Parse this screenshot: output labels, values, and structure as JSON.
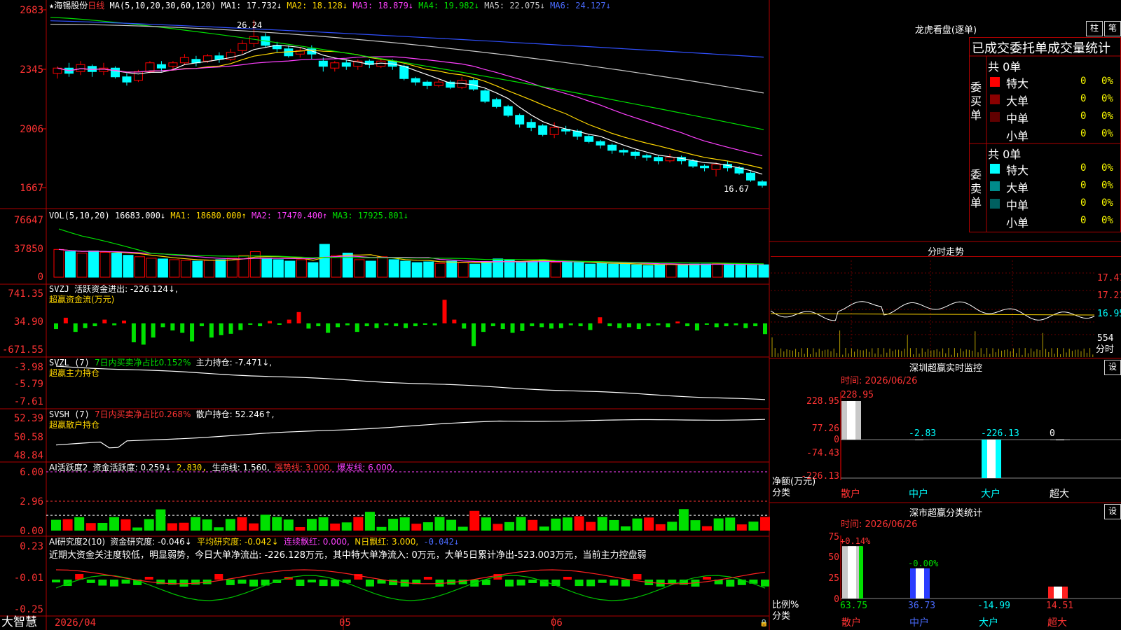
{
  "stock": {
    "star": "★",
    "name": "海锡股份",
    "period": "日线"
  },
  "ma": {
    "label": "MA(5,10,20,30,60,120)",
    "ma1": "MA1: 17.732↓",
    "ma2": "MA2: 18.128↓",
    "ma3": "MA3: 18.879↓",
    "ma4": "MA4: 19.982↓",
    "ma5": "MA5: 22.075↓",
    "ma6": "MA6: 24.127↓"
  },
  "main_axis": [
    "2683",
    "2345",
    "2006",
    "1667"
  ],
  "high_label": "26.24",
  "low_label": "16.67",
  "vol": {
    "label": "VOL(5,10,20)",
    "value": "16683.000↓",
    "ma1": "MA1: 18680.000↑",
    "ma2": "MA2: 17470.400↑",
    "ma3": "MA3: 17925.801↓",
    "axis": [
      "76647",
      "37850",
      "0"
    ]
  },
  "svzj": {
    "label": "SVZJ",
    "text": "活跃资金进出: -226.124↓,",
    "sub": "超赢资金流(万元)",
    "axis": [
      "741.35",
      "34.90",
      "-671.55"
    ]
  },
  "svzl": {
    "label": "SVZL (7)",
    "ratio": "7日内买卖净占比0.152%",
    "hold": "主力持仓: -7.471↓,",
    "sub": "超赢主力持仓",
    "axis": [
      "-3.98",
      "-5.79",
      "-7.61"
    ]
  },
  "svsh": {
    "label": "SVSH (7)",
    "ratio": "7日内买卖净占比0.268%",
    "hold": "散户持仓: 52.246↑,",
    "sub": "超赢散户持仓",
    "axis": [
      "52.39",
      "50.58",
      "48.84"
    ]
  },
  "ai1": {
    "label": "AI活跃度2",
    "t1": "资金活跃度: 0.259↓",
    "t2": "2.830,",
    "t3": "生命线: 1.560,",
    "t4": "强势线: 3.000,",
    "t5": "爆发线: 6.000,",
    "axis": [
      "6.00",
      "2.96",
      "0.00"
    ]
  },
  "ai2": {
    "label": "AI研究度2(10)",
    "t1": "资金研究度: -0.046↓",
    "t2": "平均研究度: -0.042↓",
    "t3": "连续飘红: 0.000,",
    "t4": "N日飘红: 3.000,",
    "t5": "-0.042↓",
    "note": "近期大资金关注度较低，明显弱势，今日大单净流出: -226.128万元，其中特大单净流入: 0万元，大单5日累计净出-523.003万元，当前主力控盘弱",
    "axis": [
      "0.23",
      "-0.01",
      "-0.25"
    ]
  },
  "xaxis": {
    "brand": "大智慧",
    "d1": "2026/04",
    "d2": "05",
    "d3": "06"
  },
  "lhb": {
    "title": "龙虎看盘(逐单)",
    "btn1": "柱",
    "btn2": "笔",
    "header": "已成交委托单成交量统计",
    "buy": {
      "vlabel": "委买单",
      "total": "共 0单",
      "rows": [
        {
          "name": "特大",
          "v": "0",
          "p": "0%",
          "color": "#ff0000"
        },
        {
          "name": "大单",
          "v": "0",
          "p": "0%",
          "color": "#8b0000"
        },
        {
          "name": "中单",
          "v": "0",
          "p": "0%",
          "color": "#600000"
        },
        {
          "name": "小单",
          "v": "0",
          "p": "0%",
          "color": "#000000"
        }
      ]
    },
    "sell": {
      "vlabel": "委卖单",
      "total": "共 0单",
      "rows": [
        {
          "name": "特大",
          "v": "0",
          "p": "0%",
          "color": "#00ffff"
        },
        {
          "name": "大单",
          "v": "0",
          "p": "0%",
          "color": "#008b8b"
        },
        {
          "name": "中单",
          "v": "0",
          "p": "0%",
          "color": "#006060"
        },
        {
          "name": "小单",
          "v": "0",
          "p": "0%",
          "color": "#000000"
        }
      ]
    }
  },
  "fenshi": {
    "title": "分时走势",
    "axis": [
      "17.47",
      "17.21",
      "16.95",
      "554",
      "分时"
    ]
  },
  "monitor": {
    "title": "深圳超赢实时监控",
    "btn": "设",
    "time": "时间: 2026/06/26",
    "axis": [
      "228.95",
      "77.26",
      "0",
      "-74.43",
      "-226.13"
    ],
    "ylabel": "净额(万元)",
    "xlabel": "分类",
    "cats": [
      "散户",
      "中户",
      "大户",
      "超大"
    ],
    "values": [
      228.95,
      -2.83,
      -226.13,
      0
    ],
    "labels": [
      "228.95",
      "-2.83",
      "-226.13",
      "0"
    ]
  },
  "classify": {
    "title": "深市超赢分类统计",
    "btn": "设",
    "time": "时间: 2026/06/26",
    "axis": [
      "75",
      "50",
      "25",
      "0"
    ],
    "ylabel": "比例%",
    "xlabel": "分类",
    "cats": [
      "散户",
      "中户",
      "大户",
      "超大"
    ],
    "values": [
      63.75,
      36.73,
      -14.99,
      14.51
    ],
    "labels": [
      "63.75",
      "36.73",
      "-14.99",
      "14.51"
    ],
    "tops": [
      "+0.14%",
      "-0.00%",
      "",
      ""
    ]
  },
  "chart_data": [
    {
      "type": "candlestick",
      "title": "海锡股份 日线",
      "ylim": [
        16.67,
        26.83
      ],
      "candles": [
        [
          23.2,
          23.5,
          22.9,
          23.6
        ],
        [
          23.5,
          23.2,
          23.0,
          23.8
        ],
        [
          23.3,
          23.7,
          23.1,
          23.9
        ],
        [
          23.6,
          23.3,
          23.0,
          23.7
        ],
        [
          23.3,
          23.5,
          23.1,
          23.8
        ],
        [
          23.5,
          23.0,
          22.9,
          23.6
        ],
        [
          23.0,
          22.7,
          22.5,
          23.2
        ],
        [
          22.8,
          23.3,
          22.7,
          23.4
        ],
        [
          23.3,
          23.8,
          23.2,
          23.9
        ],
        [
          23.7,
          23.5,
          23.3,
          23.9
        ],
        [
          23.6,
          23.8,
          23.4,
          23.9
        ],
        [
          23.8,
          24.1,
          23.7,
          24.3
        ],
        [
          24.0,
          23.8,
          23.6,
          24.2
        ],
        [
          23.9,
          24.2,
          23.8,
          24.3
        ],
        [
          24.2,
          24.0,
          23.8,
          24.4
        ],
        [
          24.0,
          24.4,
          23.9,
          24.6
        ],
        [
          24.5,
          24.9,
          24.3,
          25.1
        ],
        [
          24.9,
          25.3,
          24.7,
          26.24
        ],
        [
          25.3,
          24.8,
          24.7,
          25.5
        ],
        [
          24.8,
          24.6,
          24.4,
          25.0
        ],
        [
          24.6,
          24.2,
          24.1,
          24.8
        ],
        [
          24.3,
          24.5,
          24.1,
          24.7
        ],
        [
          24.6,
          24.3,
          24.0,
          24.8
        ],
        [
          23.9,
          23.6,
          23.3,
          24.1
        ],
        [
          23.5,
          23.8,
          23.3,
          23.9
        ],
        [
          23.8,
          23.6,
          23.4,
          24.0
        ],
        [
          23.6,
          23.9,
          23.4,
          24.0
        ],
        [
          23.9,
          23.7,
          23.5,
          24.0
        ],
        [
          23.6,
          23.9,
          23.5,
          24.0
        ],
        [
          23.9,
          23.6,
          23.4,
          24.0
        ],
        [
          23.6,
          22.9,
          22.8,
          23.7
        ],
        [
          22.9,
          22.7,
          22.5,
          23.0
        ],
        [
          22.7,
          22.5,
          22.3,
          22.8
        ],
        [
          22.5,
          22.7,
          22.4,
          22.9
        ],
        [
          22.7,
          22.4,
          22.3,
          22.8
        ],
        [
          22.4,
          22.8,
          22.3,
          23.0
        ],
        [
          22.8,
          22.3,
          22.2,
          22.9
        ],
        [
          22.2,
          21.6,
          21.5,
          22.3
        ],
        [
          21.7,
          21.3,
          21.2,
          21.8
        ],
        [
          21.3,
          20.8,
          20.7,
          21.4
        ],
        [
          20.8,
          20.3,
          20.1,
          20.9
        ],
        [
          20.4,
          20.1,
          19.9,
          20.6
        ],
        [
          20.2,
          19.7,
          19.6,
          20.3
        ],
        [
          19.7,
          20.1,
          19.5,
          20.4
        ],
        [
          20.0,
          19.9,
          19.7,
          20.2
        ],
        [
          19.9,
          19.6,
          19.4,
          20.0
        ],
        [
          19.6,
          19.3,
          19.2,
          19.7
        ],
        [
          19.3,
          19.1,
          18.9,
          19.4
        ],
        [
          19.1,
          18.8,
          18.6,
          19.2
        ],
        [
          18.8,
          18.7,
          18.5,
          18.9
        ],
        [
          18.7,
          18.5,
          18.3,
          18.8
        ],
        [
          18.5,
          18.4,
          18.2,
          18.6
        ],
        [
          18.4,
          18.2,
          18.0,
          18.5
        ],
        [
          18.2,
          18.4,
          18.1,
          18.6
        ],
        [
          18.4,
          18.2,
          18.0,
          18.5
        ],
        [
          18.2,
          17.9,
          17.8,
          18.3
        ],
        [
          17.9,
          17.8,
          17.6,
          18.0
        ],
        [
          17.7,
          18.0,
          17.3,
          18.1
        ],
        [
          18.0,
          17.8,
          17.6,
          18.2
        ],
        [
          17.8,
          17.5,
          17.4,
          17.9
        ],
        [
          17.5,
          17.1,
          17.0,
          17.6
        ],
        [
          17.0,
          16.8,
          16.67,
          17.1
        ]
      ],
      "ma_series": {
        "ma1_end": 17.732,
        "ma2_end": 18.128,
        "ma3_end": 18.879,
        "ma4_end": 19.982,
        "ma5_end": 22.075,
        "ma6_end": 24.127
      }
    },
    {
      "type": "bar",
      "title": "VOL(5,10,20)",
      "ylim": [
        0,
        76647
      ],
      "values": [
        38000,
        35000,
        33000,
        36000,
        34000,
        33000,
        30000,
        28000,
        26000,
        25000,
        24000,
        23000,
        22000,
        23000,
        24000,
        26000,
        30000,
        35000,
        26000,
        24000,
        22000,
        24000,
        20000,
        45000,
        30000,
        33000,
        24000,
        22000,
        28000,
        24000,
        22000,
        20000,
        21000,
        19000,
        22000,
        20000,
        18000,
        21000,
        25000,
        24000,
        20000,
        22000,
        23000,
        20000,
        21000,
        20000,
        18000,
        19000,
        18000,
        19000,
        17000,
        16000,
        17000,
        18000,
        17000,
        18000,
        18000,
        19000,
        18000,
        17000,
        16683,
        17000
      ],
      "up": [
        1,
        0,
        1,
        0,
        1,
        0,
        0,
        1,
        1,
        0,
        1,
        1,
        0,
        1,
        0,
        1,
        1,
        1,
        0,
        0,
        0,
        1,
        0,
        0,
        1,
        0,
        1,
        0,
        1,
        0,
        0,
        0,
        0,
        1,
        0,
        1,
        0,
        0,
        0,
        0,
        0,
        0,
        0,
        1,
        0,
        0,
        0,
        0,
        0,
        0,
        0,
        0,
        0,
        1,
        0,
        0,
        0,
        1,
        0,
        0,
        0,
        0
      ]
    },
    {
      "type": "bar",
      "title": "SVZJ 超赢资金流(万元)",
      "ylim": [
        -671.55,
        741.35
      ],
      "values": [
        -120,
        120,
        -180,
        -100,
        -60,
        80,
        -40,
        60,
        -400,
        -450,
        -300,
        -80,
        -150,
        -200,
        -380,
        -60,
        -300,
        -250,
        -220,
        -140,
        -30,
        -60,
        50,
        -20,
        80,
        240,
        -110,
        -60,
        -200,
        -80,
        -40,
        -180,
        -60,
        -100,
        -40,
        -60,
        -100,
        -60,
        -20,
        -40,
        500,
        80,
        -110,
        -480,
        -180,
        -60,
        -120,
        -200,
        -160,
        -60,
        -80,
        -110,
        -100,
        -40,
        -60,
        -140,
        130,
        -60,
        -100,
        -80,
        -120,
        -60,
        -40,
        -80,
        40,
        -60,
        -150,
        -20,
        -80,
        -60,
        -40,
        -100,
        -60,
        -226.124
      ]
    },
    {
      "type": "line",
      "title": "SVZL 超赢主力持仓",
      "ylim": [
        -7.61,
        -3.98
      ]
    },
    {
      "type": "line",
      "title": "SVSH 超赢散户持仓",
      "ylim": [
        48.84,
        52.39
      ]
    },
    {
      "type": "bar",
      "title": "AI活跃度2",
      "ylim": [
        0,
        6
      ]
    },
    {
      "type": "bar",
      "title": "AI研究度2(10)",
      "ylim": [
        -0.25,
        0.23
      ]
    },
    {
      "type": "bar",
      "title": "深圳超赢实时监控",
      "categories": [
        "散户",
        "中户",
        "大户",
        "超大"
      ],
      "values": [
        228.95,
        -2.83,
        -226.13,
        0
      ],
      "ylim": [
        -226.13,
        228.95
      ]
    },
    {
      "type": "bar",
      "title": "深市超赢分类统计",
      "categories": [
        "散户",
        "中户",
        "大户",
        "超大"
      ],
      "values": [
        63.75,
        36.73,
        -14.99,
        14.51
      ],
      "ylim": [
        0,
        75
      ]
    }
  ]
}
